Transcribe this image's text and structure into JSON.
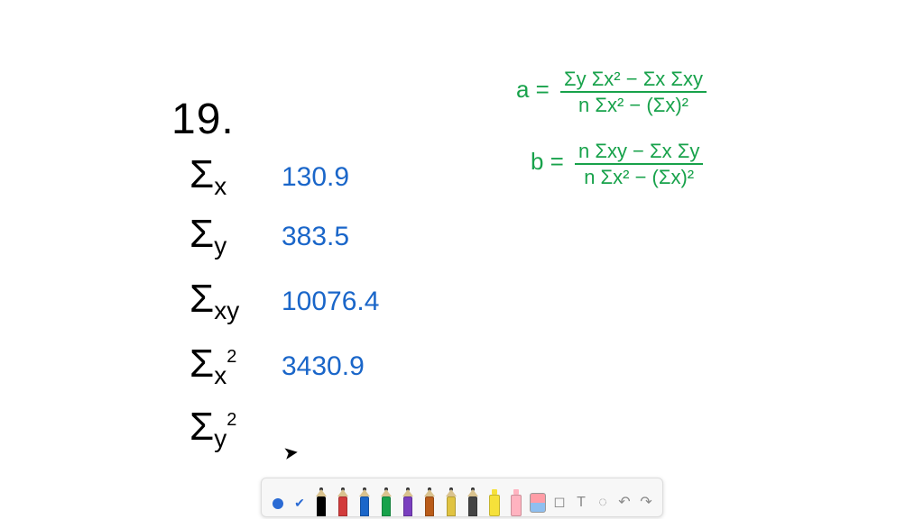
{
  "problem_number": "19.",
  "sums": {
    "sum_x": {
      "label_html": "Σ<span class='sub'>x</span>",
      "value": "130.9"
    },
    "sum_y": {
      "label_html": "Σ<span class='sub'>y</span>",
      "value": "383.5"
    },
    "sum_xy": {
      "label_html": "Σ<span class='sub'>xy</span>",
      "value": "10076.4"
    },
    "sum_x2": {
      "label_html": "Σ<span class='sub'>x</span><span class='sup'>2</span>",
      "value": "3430.9"
    },
    "sum_y2": {
      "label_html": "Σ<span class='sub'>y</span><span class='sup'>2</span>",
      "value": ""
    }
  },
  "formulas": {
    "a": {
      "lhs": "a =",
      "numerator": "Σy Σx² − Σx Σxy",
      "denominator": "n Σx² − (Σx)²"
    },
    "b": {
      "lhs": "b =",
      "numerator": "n Σxy − Σx Σy",
      "denominator": "n Σx² − (Σx)²"
    }
  },
  "toolbar": {
    "pen_colors": [
      "#000000",
      "#d23b3b",
      "#1a66c9",
      "#18a24b",
      "#7a3fbf",
      "#b95c1a",
      "#e0c341",
      "#444444"
    ],
    "marker_colors": [
      "#f6e13a",
      "#ffb3c0"
    ],
    "icons": {
      "record": "record-dot",
      "check": "check-icon",
      "eraser": "eraser-icon",
      "shapes": "shapes-icon",
      "text": "text-icon",
      "lasso": "lasso-icon",
      "undo": "undo-icon",
      "redo": "redo-icon"
    }
  }
}
